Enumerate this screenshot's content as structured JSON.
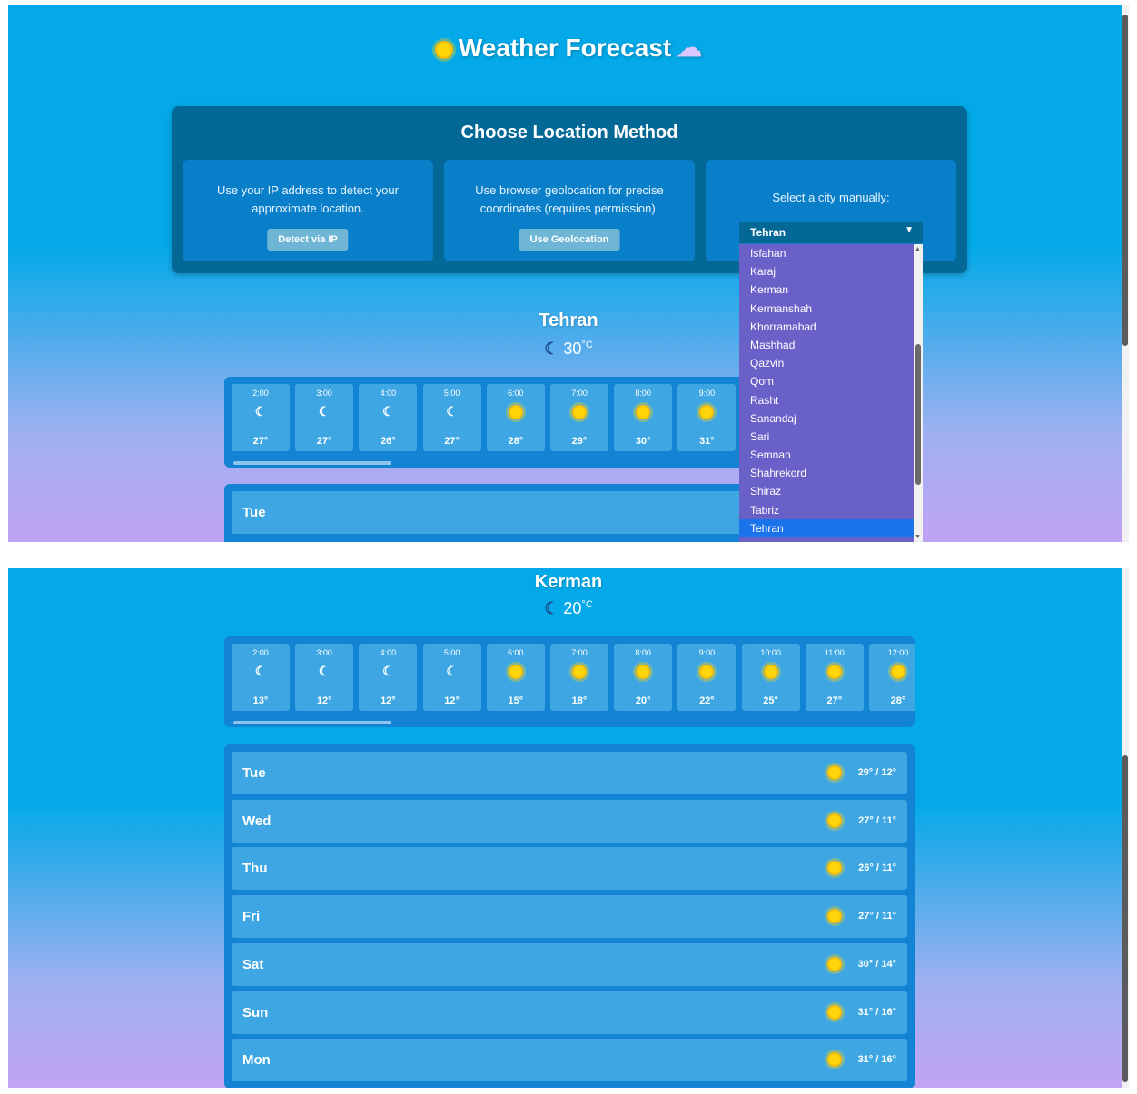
{
  "app": {
    "title": "Weather Forecast",
    "title_icon_left": "sun-icon",
    "title_icon_right": "cloud-rain-icon"
  },
  "choose": {
    "title": "Choose Location Method",
    "ip": {
      "text": "Use your IP address to detect your approximate location.",
      "button": "Detect via IP"
    },
    "geo": {
      "text": "Use browser geolocation for precise coordinates (requires permission).",
      "button": "Use Geolocation"
    },
    "manual": {
      "text": "Select a city manually:",
      "selected": "Tehran",
      "arrow": "▼"
    }
  },
  "dropdown": {
    "options": [
      "Isfahan",
      "Karaj",
      "Kerman",
      "Kermanshah",
      "Khorramabad",
      "Mashhad",
      "Qazvin",
      "Qom",
      "Rasht",
      "Sanandaj",
      "Sari",
      "Semnan",
      "Shahrekord",
      "Shiraz",
      "Tabriz",
      "Tehran"
    ],
    "selected": "Tehran"
  },
  "view1": {
    "location": "Tehran",
    "current": {
      "icon": "moon-icon",
      "temp": "30",
      "unit": "°C"
    },
    "hourly": [
      {
        "time": "2:00",
        "icon": "moon",
        "temp": "27°"
      },
      {
        "time": "3:00",
        "icon": "moon",
        "temp": "27°"
      },
      {
        "time": "4:00",
        "icon": "moon",
        "temp": "26°"
      },
      {
        "time": "5:00",
        "icon": "moon",
        "temp": "27°"
      },
      {
        "time": "6:00",
        "icon": "sun",
        "temp": "28°"
      },
      {
        "time": "7:00",
        "icon": "sun",
        "temp": "29°"
      },
      {
        "time": "8:00",
        "icon": "sun",
        "temp": "30°"
      },
      {
        "time": "9:00",
        "icon": "sun",
        "temp": "31°"
      }
    ],
    "daily": [
      {
        "day": "Tue"
      }
    ]
  },
  "view2": {
    "location": "Kerman",
    "current": {
      "icon": "moon-icon",
      "temp": "20",
      "unit": "°C"
    },
    "hourly": [
      {
        "time": "2:00",
        "icon": "moon",
        "temp": "13°"
      },
      {
        "time": "3:00",
        "icon": "moon",
        "temp": "12°"
      },
      {
        "time": "4:00",
        "icon": "moon",
        "temp": "12°"
      },
      {
        "time": "5:00",
        "icon": "moon",
        "temp": "12°"
      },
      {
        "time": "6:00",
        "icon": "sun",
        "temp": "15°"
      },
      {
        "time": "7:00",
        "icon": "sun",
        "temp": "18°"
      },
      {
        "time": "8:00",
        "icon": "sun",
        "temp": "20°"
      },
      {
        "time": "9:00",
        "icon": "sun",
        "temp": "22°"
      },
      {
        "time": "10:00",
        "icon": "sun",
        "temp": "25°"
      },
      {
        "time": "11:00",
        "icon": "sun",
        "temp": "27°"
      },
      {
        "time": "12:00",
        "icon": "sun",
        "temp": "28°"
      }
    ],
    "daily": [
      {
        "day": "Tue",
        "icon": "sun",
        "temps": "29° / 12°"
      },
      {
        "day": "Wed",
        "icon": "sun",
        "temps": "27° / 11°"
      },
      {
        "day": "Thu",
        "icon": "sun",
        "temps": "26° / 11°"
      },
      {
        "day": "Fri",
        "icon": "sun",
        "temps": "27° / 11°"
      },
      {
        "day": "Sat",
        "icon": "sun",
        "temps": "30° / 14°"
      },
      {
        "day": "Sun",
        "icon": "sun",
        "temps": "31° / 16°"
      },
      {
        "day": "Mon",
        "icon": "sun",
        "temps": "31° / 16°"
      }
    ]
  },
  "colors": {
    "bg_top": "#03a9e8",
    "bg_bottom": "#c1a4f4",
    "panel": "#036896",
    "card": "#0a7fc9",
    "tile": "#3ea7e3",
    "dropdown": "#6a61c8",
    "selected": "#1a73e8"
  }
}
